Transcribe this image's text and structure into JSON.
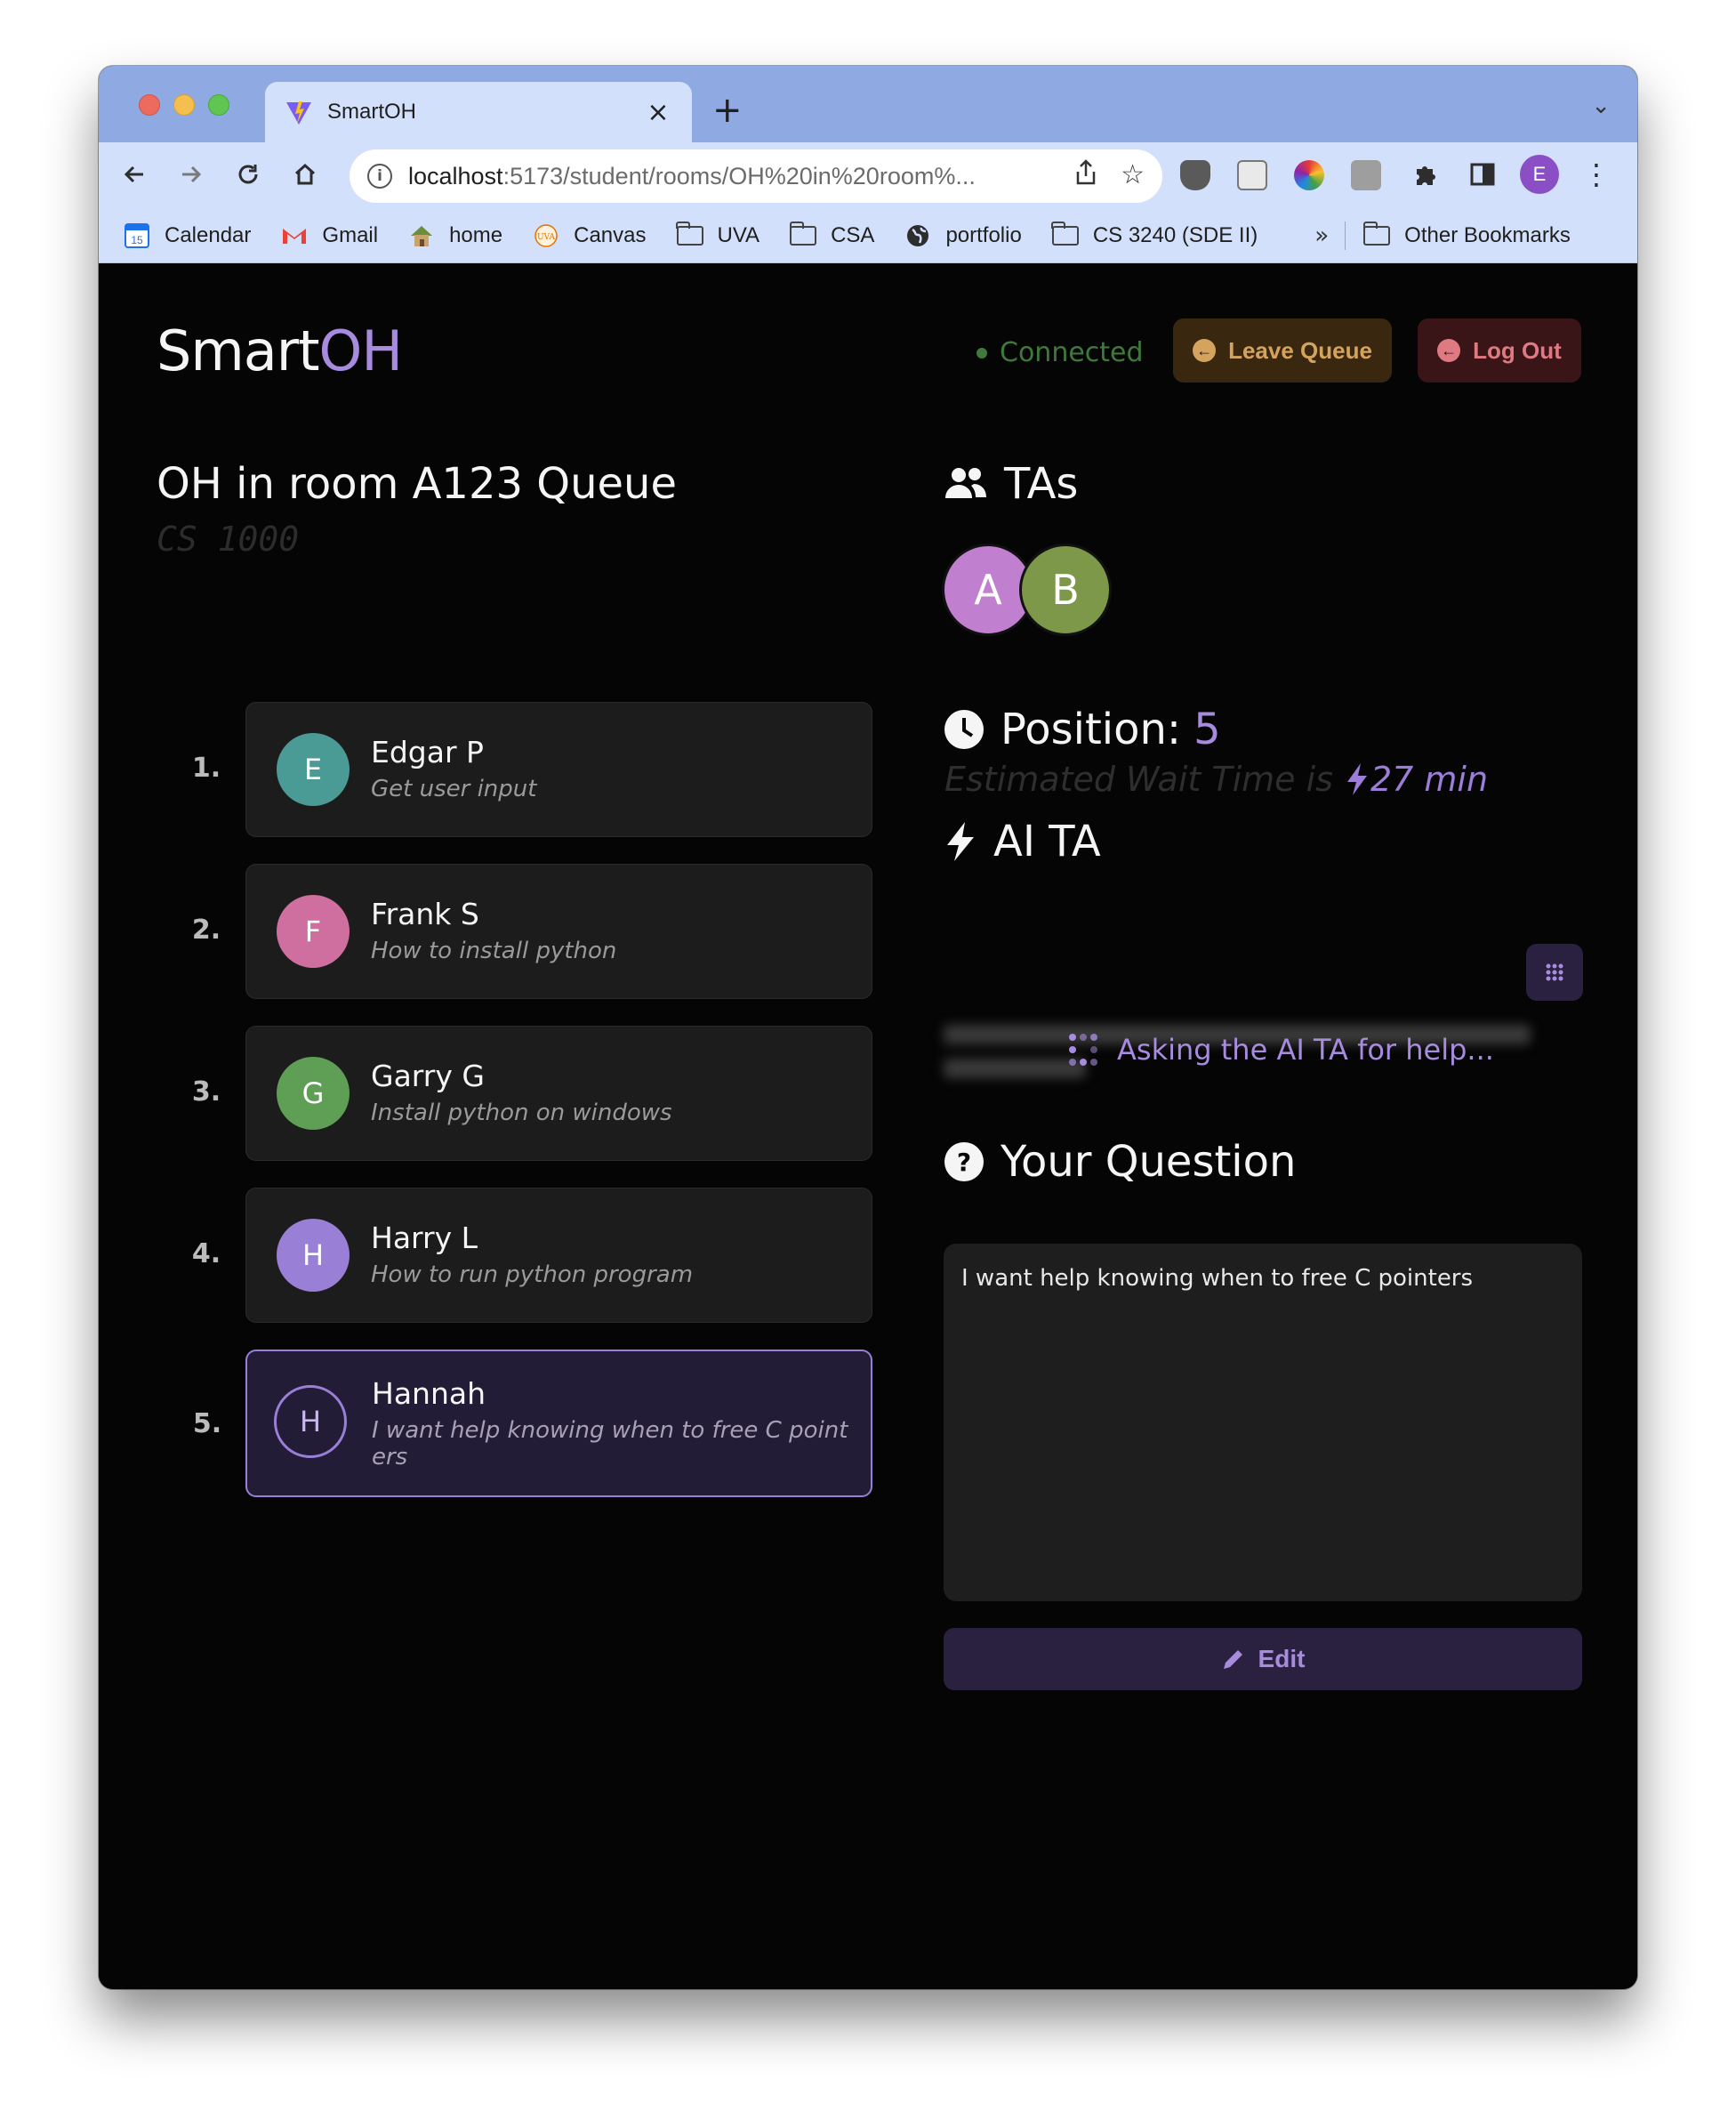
{
  "browser": {
    "tab_title": "SmartOH",
    "url_host": "localhost",
    "url_rest": ":5173/student/rooms/OH%20in%20room%...",
    "profile_initial": "E",
    "bookmarks": [
      {
        "label": "Calendar",
        "icon": "calendar-icon"
      },
      {
        "label": "Gmail",
        "icon": "gmail-icon"
      },
      {
        "label": "home",
        "icon": "home-icon"
      },
      {
        "label": "Canvas",
        "icon": "canvas-icon"
      },
      {
        "label": "UVA",
        "icon": "folder-icon"
      },
      {
        "label": "CSA",
        "icon": "folder-icon"
      },
      {
        "label": "portfolio",
        "icon": "globe-icon"
      },
      {
        "label": "CS 3240 (SDE II)",
        "icon": "folder-icon"
      }
    ],
    "more": "»",
    "other_bookmarks": "Other Bookmarks"
  },
  "header": {
    "brand_a": "Smart",
    "brand_b": "OH",
    "status": "Connected",
    "leave_label": "Leave Queue",
    "logout_label": "Log Out"
  },
  "queue": {
    "title": "OH in room A123 Queue",
    "course": "CS 1000",
    "entries": [
      {
        "num": "1.",
        "initial": "E",
        "name": "Edgar P",
        "question": "Get user input",
        "color": "#4a9a96"
      },
      {
        "num": "2.",
        "initial": "F",
        "name": "Frank S",
        "question": "How to install python",
        "color": "#cf6f9f"
      },
      {
        "num": "3.",
        "initial": "G",
        "name": "Garry G",
        "question": "Install python on windows",
        "color": "#5e9e55"
      },
      {
        "num": "4.",
        "initial": "H",
        "name": "Harry L",
        "question": "How to run python program",
        "color": "#9a7fd6"
      },
      {
        "num": "5.",
        "initial": "H",
        "name": "Hannah",
        "question": "I want help knowing when to free C pointers",
        "color": "#9a7fd6"
      }
    ]
  },
  "tas": {
    "heading": "TAs",
    "list": [
      {
        "initial": "A",
        "color": "#c17fcf"
      },
      {
        "initial": "B",
        "color": "#7d9848"
      }
    ]
  },
  "position": {
    "label": "Position:",
    "value": "5",
    "wait_prefix": "Estimated Wait Time is",
    "wait_value": "27 min"
  },
  "ai_ta": {
    "heading": "AI TA",
    "status": "Asking the AI TA for help..."
  },
  "question": {
    "heading": "Your Question",
    "text": "I want help knowing when to free C pointers",
    "edit_label": "Edit"
  }
}
